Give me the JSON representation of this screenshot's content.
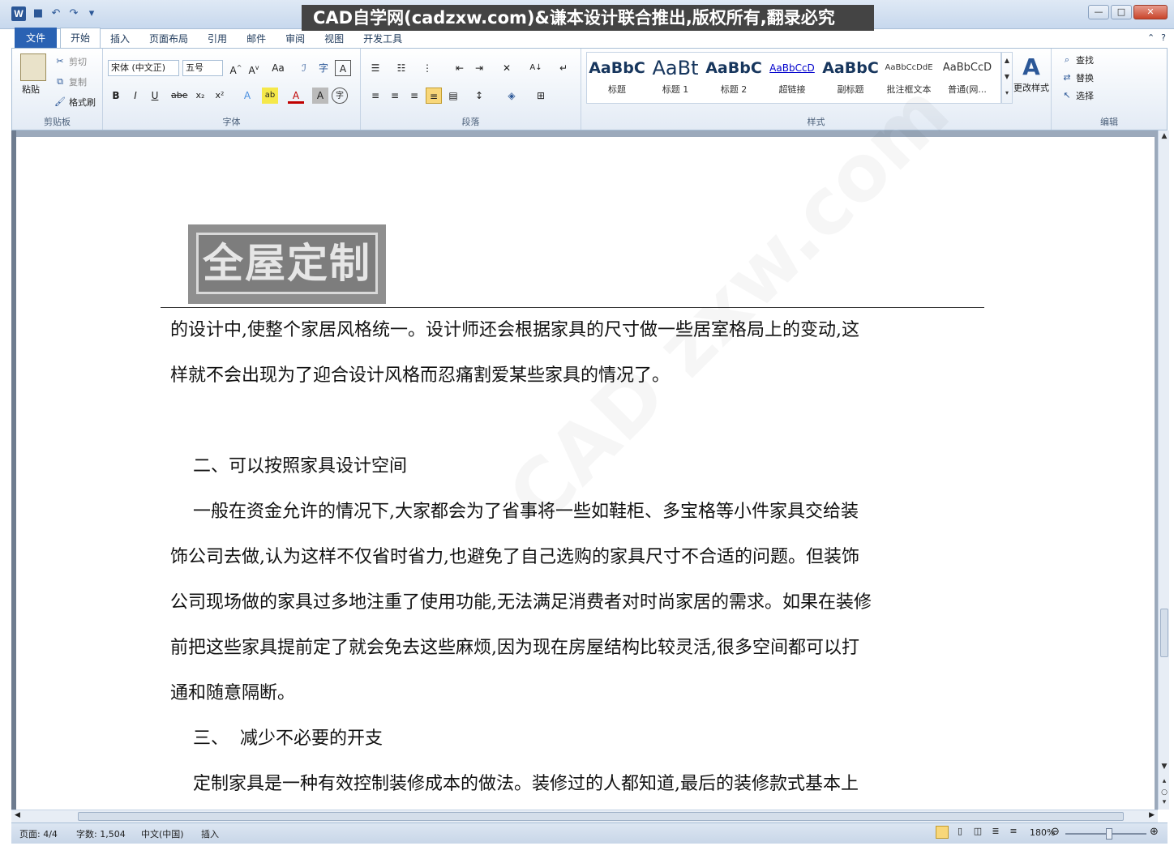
{
  "title_bar": {
    "banner": "CAD自学网(cadzxw.com)&谦本设计联合推出,版权所有,翻录必究"
  },
  "tabs": [
    "文件",
    "开始",
    "插入",
    "页面布局",
    "引用",
    "邮件",
    "审阅",
    "视图",
    "开发工具"
  ],
  "clipboard": {
    "paste": "粘贴",
    "cut": "剪切",
    "copy": "复制",
    "format_painter": "格式刷",
    "group_label": "剪贴板"
  },
  "font": {
    "font_name": "宋体 (中文正)",
    "font_size": "五号",
    "group_label": "字体"
  },
  "paragraph": {
    "group_label": "段落"
  },
  "styles": {
    "items": [
      {
        "preview": "AaBbC",
        "name": "标题"
      },
      {
        "preview": "AaBt",
        "name": "标题 1"
      },
      {
        "preview": "AaBbC",
        "name": "标题 2"
      },
      {
        "preview": "AaBbCcD",
        "name": "超链接"
      },
      {
        "preview": "AaBbC",
        "name": "副标题"
      },
      {
        "preview": "AaBbCcDdE",
        "name": "批注框文本"
      },
      {
        "preview": "AaBbCcD",
        "name": "普通(网..."
      }
    ],
    "change_styles": "更改样式",
    "group_label": "样式"
  },
  "editing": {
    "find": "查找",
    "replace": "替换",
    "select": "选择",
    "group_label": "编辑"
  },
  "document": {
    "image_text": "全屋定制",
    "paragraphs": [
      "的设计中,使整个家居风格统一。设计师还会根据家具的尺寸做一些居室格局上的变动,这",
      "样就不会出现为了迎合设计风格而忍痛割爱某些家具的情况了。",
      "",
      "    二、可以按照家具设计空间",
      "    一般在资金允许的情况下,大家都会为了省事将一些如鞋柜、多宝格等小件家具交给装",
      "饰公司去做,认为这样不仅省时省力,也避免了自己选购的家具尺寸不合适的问题。但装饰",
      "公司现场做的家具过多地注重了使用功能,无法满足消费者对时尚家居的需求。如果在装修",
      "前把这些家具提前定了就会免去这些麻烦,因为现在房屋结构比较灵活,很多空间都可以打",
      "通和随意隔断。",
      "    三、  减少不必要的开支",
      "    定制家具是一种有效控制装修成本的做法。装修过的人都知道,最后的装修款式基本上"
    ]
  },
  "status": {
    "page": "页面: 4/4",
    "words": "字数: 1,504",
    "language": "中文(中国)",
    "mode": "插入",
    "zoom": "180%"
  }
}
